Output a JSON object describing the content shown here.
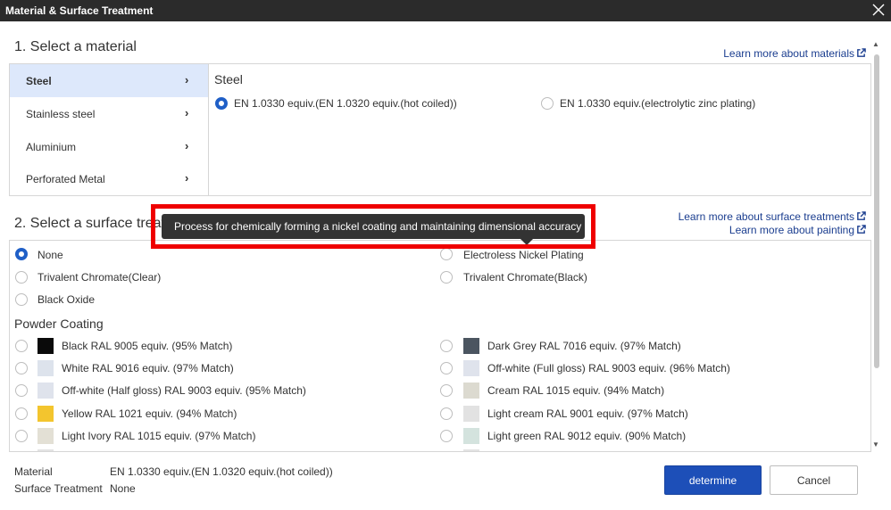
{
  "window": {
    "title": "Material & Surface Treatment"
  },
  "material_section": {
    "title": "1. Select a material",
    "learn_more": "Learn more about materials",
    "categories": [
      {
        "label": "Steel",
        "active": true
      },
      {
        "label": "Stainless steel",
        "active": false
      },
      {
        "label": "Aluminium",
        "active": false
      },
      {
        "label": "Perforated Metal",
        "active": false
      }
    ],
    "group_title": "Steel",
    "options": [
      {
        "label": "EN 1.0330 equiv.(EN 1.0320 equiv.(hot coiled))",
        "checked": true
      },
      {
        "label": "EN 1.0330 equiv.(electrolytic zinc plating)",
        "checked": false
      }
    ]
  },
  "surface_section": {
    "title": "2. Select a surface treatment",
    "learn_more_treatments": "Learn more about surface treatments",
    "learn_more_painting": "Learn more about painting",
    "basic_options": [
      {
        "label": "None",
        "checked": true
      },
      {
        "label": "Electroless Nickel Plating",
        "checked": false
      },
      {
        "label": "Trivalent Chromate(Clear)",
        "checked": false
      },
      {
        "label": "Trivalent Chromate(Black)",
        "checked": false
      },
      {
        "label": "Black Oxide",
        "checked": false
      }
    ],
    "powder_coating_title": "Powder Coating",
    "powder_options": [
      {
        "label": "Black RAL 9005 equiv. (95% Match)",
        "color": "#0a0a0a"
      },
      {
        "label": "Dark Grey RAL 7016 equiv. (97% Match)",
        "color": "#4b5560"
      },
      {
        "label": "White RAL 9016 equiv. (97% Match)",
        "color": "#dde3ec"
      },
      {
        "label": "Off-white (Full gloss) RAL 9003 equiv. (96% Match)",
        "color": "#dfe3ec"
      },
      {
        "label": "Off-white (Half gloss) RAL 9003 equiv. (95% Match)",
        "color": "#dfe3ec"
      },
      {
        "label": "Cream RAL 1015 equiv. (94% Match)",
        "color": "#dcdad0"
      },
      {
        "label": "Yellow RAL 1021 equiv. (94% Match)",
        "color": "#f3c52e"
      },
      {
        "label": "Light cream RAL 9001 equiv. (97% Match)",
        "color": "#e2e2e2"
      },
      {
        "label": "Light Ivory RAL 1015 equiv. (97% Match)",
        "color": "#e3e0d5"
      },
      {
        "label": "Light green RAL 9012 equiv. (90% Match)",
        "color": "#d4e3de"
      }
    ]
  },
  "tooltip": {
    "text": "Process for chemically forming a nickel coating and maintaining dimensional accuracy"
  },
  "summary": {
    "material_label": "Material",
    "material_value": "EN 1.0330 equiv.(EN 1.0320 equiv.(hot coiled))",
    "surface_label": "Surface Treatment",
    "surface_value": "None"
  },
  "buttons": {
    "determine": "determine",
    "cancel": "Cancel"
  }
}
